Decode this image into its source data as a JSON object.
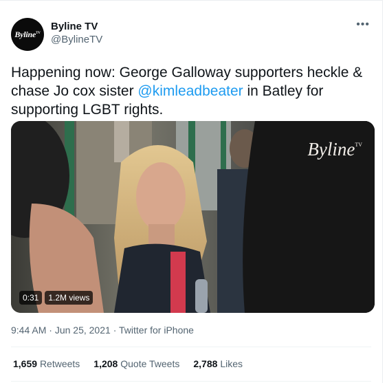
{
  "author": {
    "avatar_text": "Byline",
    "avatar_sup": "TV",
    "name": "Byline TV",
    "handle": "@BylineTV"
  },
  "more_label": "•••",
  "tweet": {
    "text_before": "Happening now: George Galloway supporters heckle & chase Jo cox sister ",
    "mention": "@kimleadbeater",
    "text_after": " in Batley for supporting LGBT rights."
  },
  "media": {
    "watermark": "Byline",
    "watermark_sup": "TV",
    "duration": "0:31",
    "views": "1.2M views"
  },
  "meta": {
    "time": "9:44 AM",
    "separator": "·",
    "date": "Jun 25, 2021",
    "source": "Twitter for iPhone"
  },
  "stats": {
    "retweets_count": "1,659",
    "retweets_label": "Retweets",
    "quotes_count": "1,208",
    "quotes_label": "Quote Tweets",
    "likes_count": "2,788",
    "likes_label": "Likes"
  }
}
